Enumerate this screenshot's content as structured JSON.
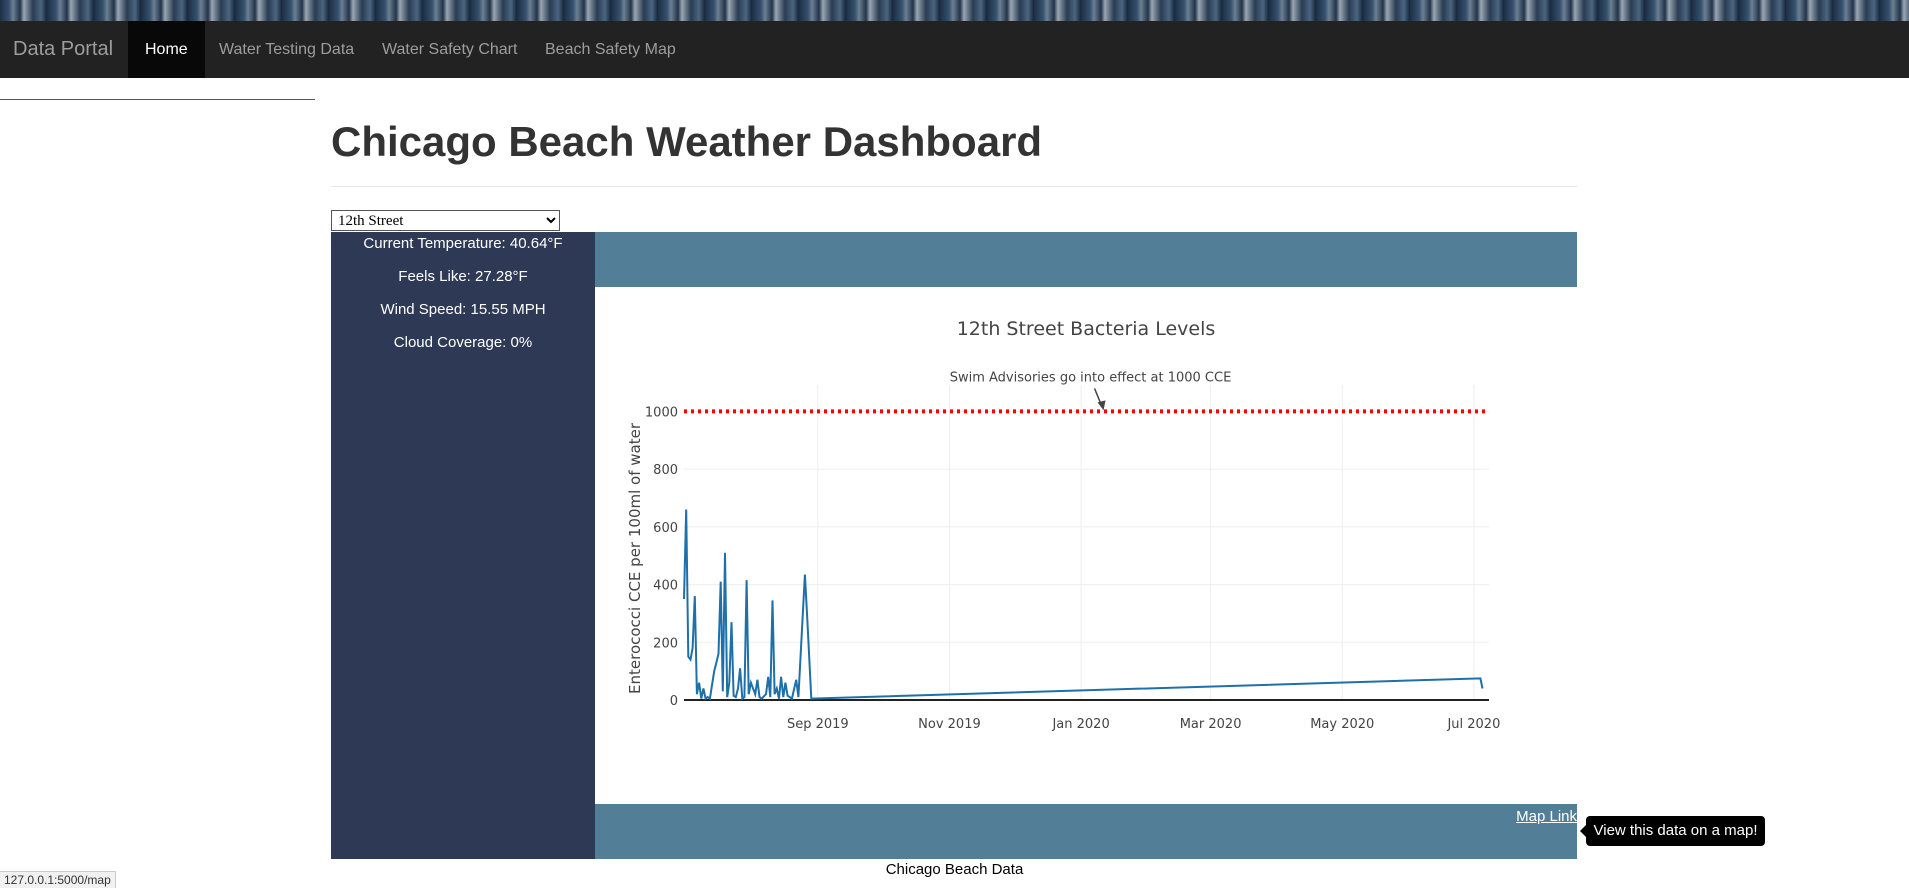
{
  "nav": {
    "brand": "Data Portal",
    "items": [
      {
        "label": "Home",
        "active": true
      },
      {
        "label": "Water Testing Data",
        "active": false
      },
      {
        "label": "Water Safety Chart",
        "active": false
      },
      {
        "label": "Beach Safety Map",
        "active": false
      }
    ]
  },
  "page": {
    "title": "Chicago Beach Weather Dashboard",
    "footer": "Chicago Beach Data",
    "status_url": "127.0.0.1:5000/map"
  },
  "beach_select": {
    "selected": "12th Street",
    "options": [
      "12th Street"
    ]
  },
  "weather": {
    "temperature": "Current Temperature: 40.64°F",
    "feels_like": "Feels Like: 27.28°F",
    "wind_speed": "Wind Speed: 15.55 MPH",
    "cloud_coverage": "Cloud Coverage: 0%"
  },
  "map_link": {
    "label": "Map Link",
    "tooltip": "View this data on a map!"
  },
  "colors": {
    "navbar": "#222222",
    "weather_panel": "#2e3955",
    "chart_band": "#527f97",
    "series_line": "#1f6fa8",
    "threshold_line": "#ff0000"
  },
  "chart_data": {
    "type": "line",
    "title": "12th Street Bacteria Levels",
    "xlabel": "",
    "ylabel": "Enterococci CCE per 100ml of water",
    "ylim": [
      0,
      1050
    ],
    "yticks": [
      0,
      200,
      400,
      600,
      800,
      1000
    ],
    "xticks": [
      "Sep 2019",
      "Nov 2019",
      "Jan 2020",
      "Mar 2020",
      "May 2020",
      "Jul 2020"
    ],
    "xtick_dates": [
      "2019-09-01",
      "2019-11-01",
      "2020-01-01",
      "2020-03-01",
      "2020-05-01",
      "2020-07-01"
    ],
    "xlim": [
      "2019-07-01",
      "2020-07-08"
    ],
    "grid": true,
    "threshold": {
      "value": 1000,
      "style": "dotted",
      "color": "#ff0000"
    },
    "annotation": {
      "text": "Swim Advisories go into effect at 1000 CCE",
      "x": "2020-01-10",
      "y": 1000
    },
    "series": [
      {
        "points": [
          [
            "2019-07-01",
            350
          ],
          [
            "2019-07-02",
            660
          ],
          [
            "2019-07-03",
            150
          ],
          [
            "2019-07-04",
            140
          ],
          [
            "2019-07-05",
            180
          ],
          [
            "2019-07-06",
            360
          ],
          [
            "2019-07-07",
            20
          ],
          [
            "2019-07-08",
            60
          ],
          [
            "2019-07-09",
            5
          ],
          [
            "2019-07-10",
            40
          ],
          [
            "2019-07-11",
            5
          ],
          [
            "2019-07-12",
            10
          ],
          [
            "2019-07-13",
            5
          ],
          [
            "2019-07-15",
            100
          ],
          [
            "2019-07-16",
            130
          ],
          [
            "2019-07-17",
            160
          ],
          [
            "2019-07-18",
            410
          ],
          [
            "2019-07-19",
            30
          ],
          [
            "2019-07-20",
            510
          ],
          [
            "2019-07-21",
            10
          ],
          [
            "2019-07-22",
            60
          ],
          [
            "2019-07-23",
            270
          ],
          [
            "2019-07-24",
            15
          ],
          [
            "2019-07-25",
            10
          ],
          [
            "2019-07-26",
            40
          ],
          [
            "2019-07-27",
            110
          ],
          [
            "2019-07-28",
            5
          ],
          [
            "2019-07-29",
            10
          ],
          [
            "2019-07-30",
            415
          ],
          [
            "2019-07-31",
            20
          ],
          [
            "2019-08-01",
            60
          ],
          [
            "2019-08-03",
            20
          ],
          [
            "2019-08-04",
            70
          ],
          [
            "2019-08-05",
            10
          ],
          [
            "2019-08-06",
            5
          ],
          [
            "2019-08-08",
            20
          ],
          [
            "2019-08-09",
            80
          ],
          [
            "2019-08-10",
            10
          ],
          [
            "2019-08-11",
            345
          ],
          [
            "2019-08-12",
            20
          ],
          [
            "2019-08-13",
            40
          ],
          [
            "2019-08-14",
            5
          ],
          [
            "2019-08-15",
            80
          ],
          [
            "2019-08-16",
            10
          ],
          [
            "2019-08-17",
            60
          ],
          [
            "2019-08-18",
            15
          ],
          [
            "2019-08-20",
            5
          ],
          [
            "2019-08-22",
            70
          ],
          [
            "2019-08-23",
            10
          ],
          [
            "2019-08-26",
            435
          ],
          [
            "2019-08-27",
            300
          ],
          [
            "2019-08-29",
            5
          ],
          [
            "2020-07-04",
            75
          ],
          [
            "2020-07-05",
            40
          ]
        ]
      }
    ]
  }
}
